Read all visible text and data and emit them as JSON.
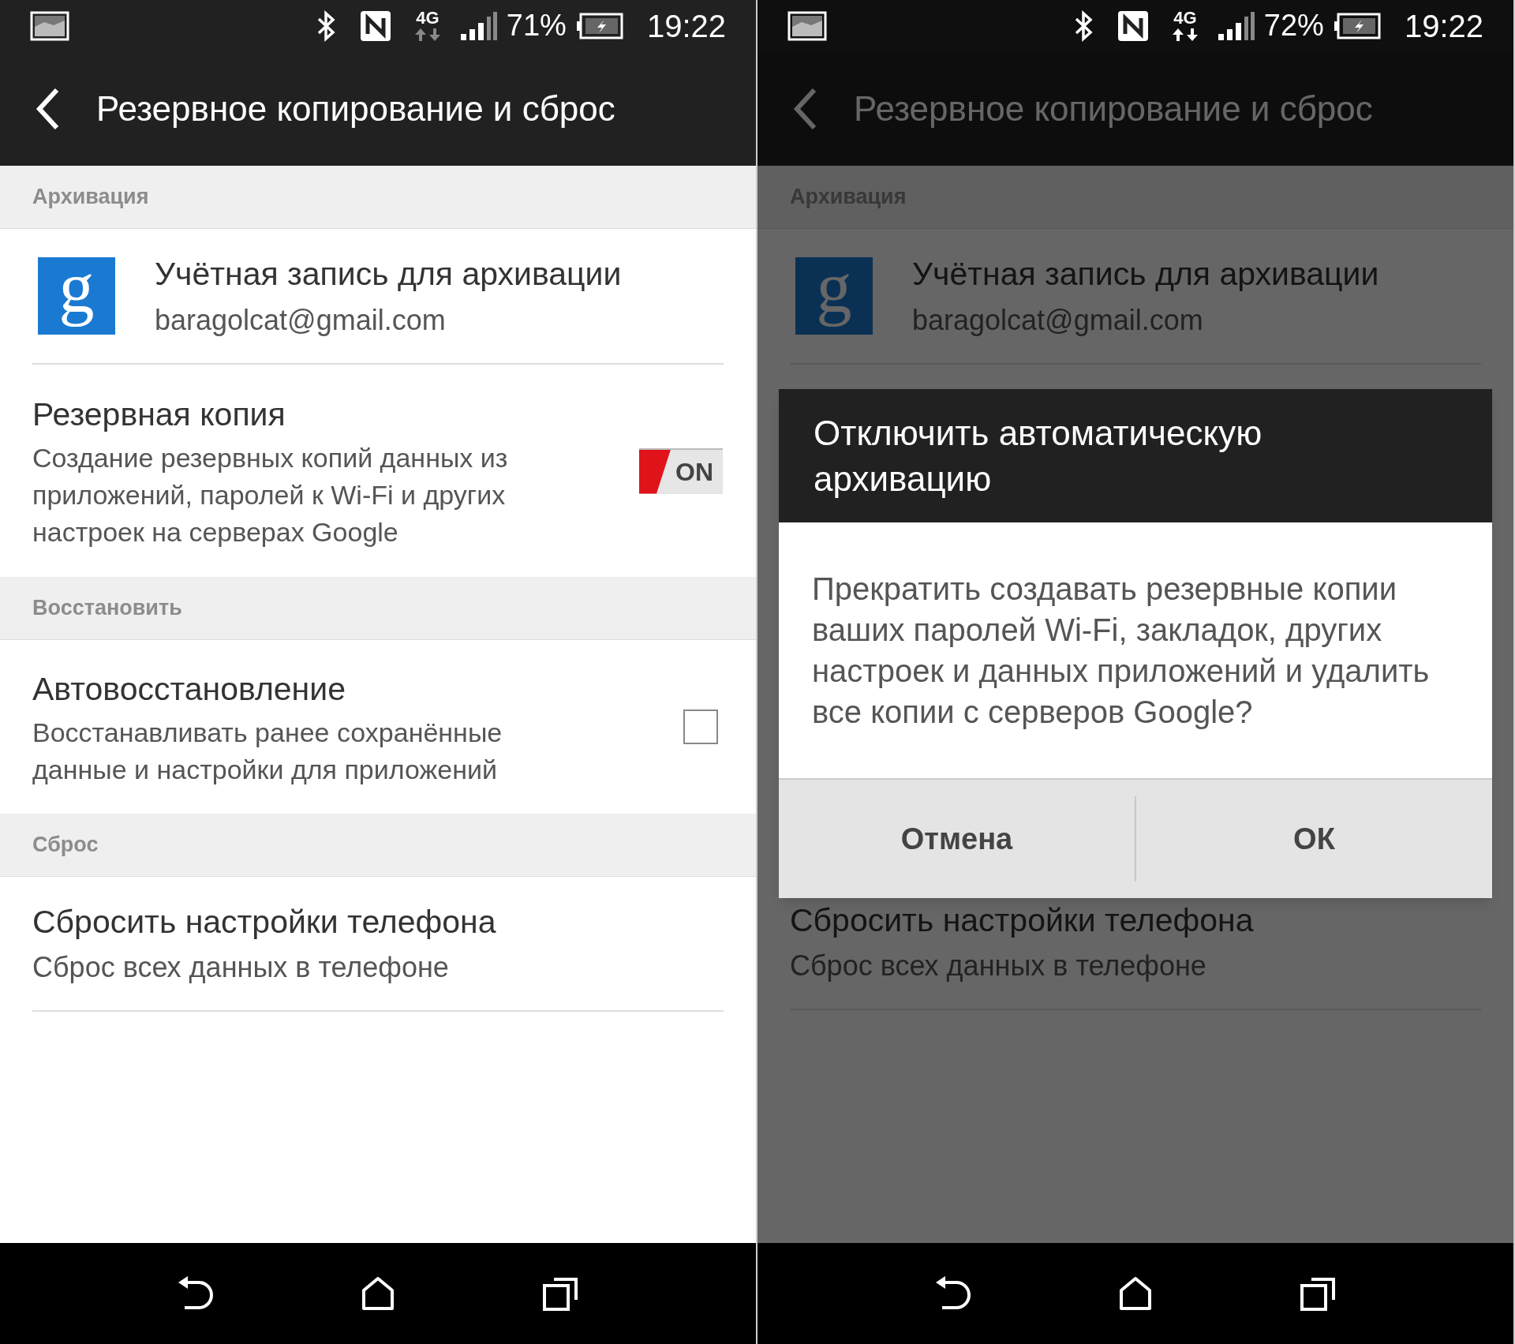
{
  "phones": [
    {
      "status_bar": {
        "network": "4G",
        "battery": "71%",
        "time": "19:22"
      },
      "app_bar": {
        "title": "Резервное копирование и сброс"
      },
      "rows": [
        {
          "kind": "header",
          "title": "Архивация"
        },
        {
          "kind": "account",
          "icon_letter": "g",
          "title": "Учётная запись для архивации",
          "summary": "baragolcat@gmail.com"
        },
        {
          "kind": "toggle",
          "title": "Резервная копия",
          "summary": "Создание резервных копий данных из приложений, паролей к Wi-Fi и других настроек на серверах Google",
          "on": true,
          "label": "ON"
        },
        {
          "kind": "header",
          "title": "Восстановить"
        },
        {
          "kind": "checkbox",
          "title": "Автовосстановление",
          "summary": "Восстанавливать ранее сохранённые данные и настройки для приложений",
          "checked": false
        },
        {
          "kind": "header",
          "title": "Сброс"
        },
        {
          "kind": "action",
          "title": "Сбросить настройки телефона",
          "summary": "Сброс всех данных в телефоне"
        }
      ]
    },
    {
      "status_bar": {
        "network": "4G",
        "battery": "72%",
        "time": "19:22"
      },
      "app_bar": {
        "title": "Резервное копирование и сброс"
      },
      "rows": [
        {
          "kind": "header",
          "title": "Архивация"
        },
        {
          "kind": "account",
          "icon_letter": "g",
          "title": "Учётная запись для архивации",
          "summary": "baragolcat@gmail.com"
        }
      ],
      "dialog": {
        "title": "Отключить автоматическую архивацию",
        "message": "Прекратить создавать резервные копии ваших паролей Wi-Fi, закладок, других настроек и данных приложений и удалить все копии с серверов Google?",
        "buttons": [
          "Отмена",
          "ОК"
        ]
      },
      "rows_after_dialog": [
        {
          "kind": "action",
          "title": "Сбросить настройки телефона",
          "summary": "Сброс всех данных в телефоне"
        }
      ]
    }
  ]
}
